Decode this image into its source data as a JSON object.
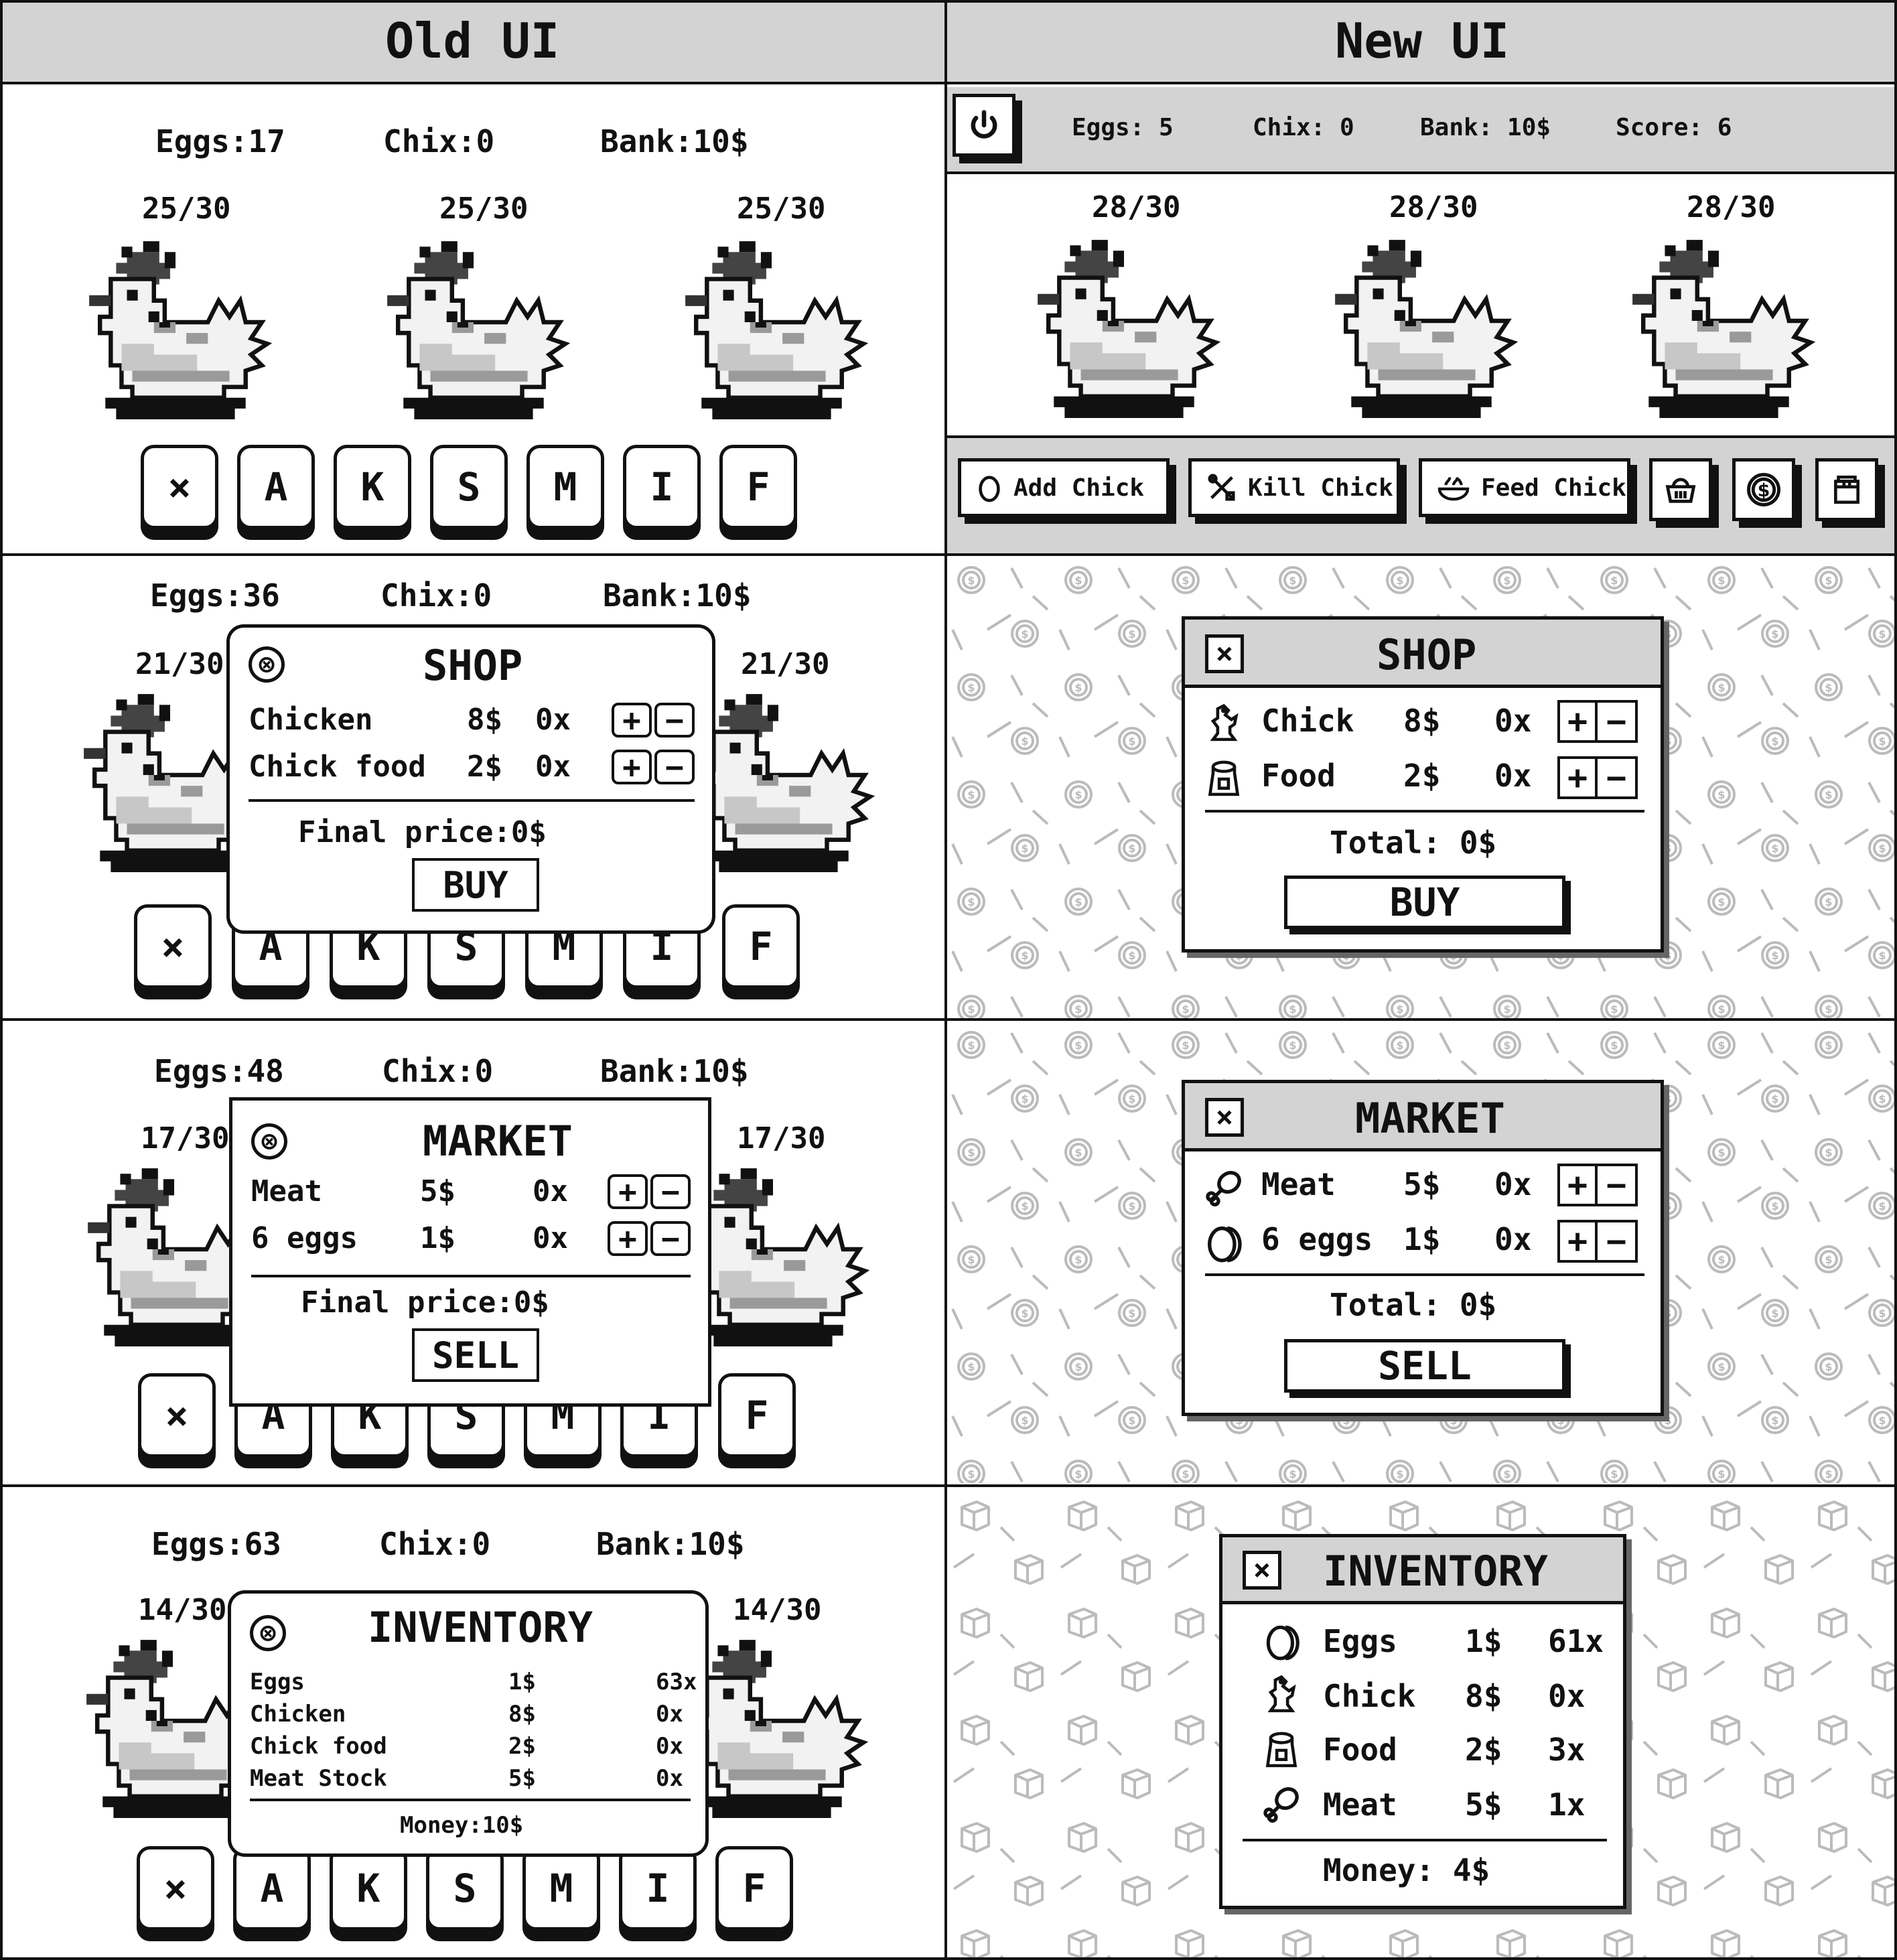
{
  "headers": {
    "old": "Old UI",
    "new": "New UI"
  },
  "old_rows": [
    {
      "eggs": "Eggs:17",
      "chix": "Chix:0",
      "bank": "Bank:10$",
      "hens": [
        "25/30",
        "25/30",
        "25/30"
      ]
    },
    {
      "eggs": "Eggs:36",
      "chix": "Chix:0",
      "bank": "Bank:10$",
      "hens": [
        "21/30",
        "21/30"
      ]
    },
    {
      "eggs": "Eggs:48",
      "chix": "Chix:0",
      "bank": "Bank:10$",
      "hens": [
        "17/30",
        "17/30"
      ]
    },
    {
      "eggs": "Eggs:63",
      "chix": "Chix:0",
      "bank": "Bank:10$",
      "hens": [
        "14/30",
        "14/30"
      ]
    }
  ],
  "old_keys": [
    "×",
    "A",
    "K",
    "S",
    "M",
    "I",
    "F"
  ],
  "old_shop": {
    "close": "⊗",
    "title": "SHOP",
    "items": [
      {
        "name": "Chicken",
        "price": "8$",
        "qty": "0x"
      },
      {
        "name": "Chick food",
        "price": "2$",
        "qty": "0x"
      }
    ],
    "final": "Final price:0$",
    "button": "BUY"
  },
  "old_market": {
    "close": "⊗",
    "title": "MARKET",
    "items": [
      {
        "name": "Meat",
        "price": "5$",
        "qty": "0x"
      },
      {
        "name": "6 eggs",
        "price": "1$",
        "qty": "0x"
      }
    ],
    "final": "Final price:0$",
    "button": "SELL"
  },
  "old_inventory": {
    "close": "⊗",
    "title": "INVENTORY",
    "items": [
      {
        "name": "Eggs",
        "price": "1$",
        "qty": "63x"
      },
      {
        "name": "Chicken",
        "price": "8$",
        "qty": "0x"
      },
      {
        "name": "Chick food",
        "price": "2$",
        "qty": "0x"
      },
      {
        "name": "Meat Stock",
        "price": "5$",
        "qty": "0x"
      }
    ],
    "money": "Money:10$"
  },
  "pm": {
    "plus": "+",
    "minus": "−"
  },
  "new_top": {
    "eggs": "Eggs: 5",
    "chix": "Chix: 0",
    "bank": "Bank: 10$",
    "score": "Score: 6",
    "hens": [
      "28/30",
      "28/30",
      "28/30"
    ]
  },
  "new_actions": {
    "add": "Add Chick",
    "kill": "Kill Chick",
    "feed": "Feed Chick"
  },
  "new_shop": {
    "close": "×",
    "title": "SHOP",
    "items": [
      {
        "name": "Chick",
        "price": "8$",
        "qty": "0x"
      },
      {
        "name": "Food",
        "price": "2$",
        "qty": "0x"
      }
    ],
    "total": "Total: 0$",
    "button": "BUY"
  },
  "new_market": {
    "close": "×",
    "title": "MARKET",
    "items": [
      {
        "name": "Meat",
        "price": "5$",
        "qty": "0x"
      },
      {
        "name": "6 eggs",
        "price": "1$",
        "qty": "0x"
      }
    ],
    "total": "Total: 0$",
    "button": "SELL"
  },
  "new_inventory": {
    "close": "×",
    "title": "INVENTORY",
    "items": [
      {
        "name": "Eggs",
        "price": "1$",
        "qty": "61x"
      },
      {
        "name": "Chick",
        "price": "8$",
        "qty": "0x"
      },
      {
        "name": "Food",
        "price": "2$",
        "qty": "3x"
      },
      {
        "name": "Meat",
        "price": "5$",
        "qty": "1x"
      }
    ],
    "money": "Money: 4$"
  }
}
